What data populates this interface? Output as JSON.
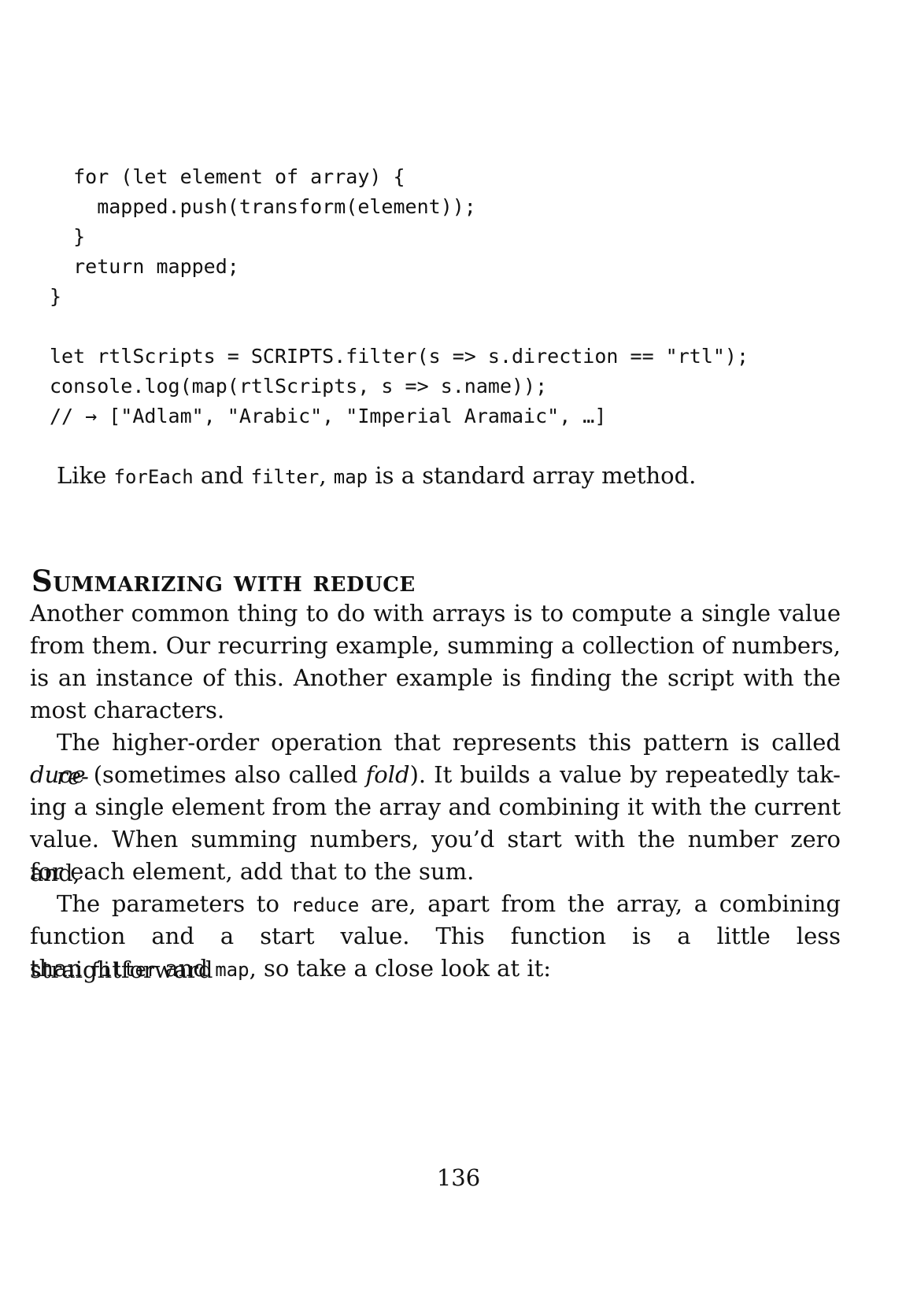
{
  "code": {
    "lines": [
      "  for (let element of array) {",
      "    mapped.push(transform(element));",
      "  }",
      "  return mapped;",
      "}",
      "",
      "let rtlScripts = SCRIPTS.filter(s => s.direction == \"rtl\");",
      "console.log(map(rtlScripts, s => s.name));",
      "// → [\"Adlam\", \"Arabic\", \"Imperial Aramaic\", …]"
    ]
  },
  "intro": {
    "t1": "Like ",
    "c1": "forEach",
    "t2": " and ",
    "c2": "filter",
    "t3": ", ",
    "c3": "map",
    "t4": " is a standard array method."
  },
  "heading": "Summarizing with reduce",
  "p1": {
    "lines": [
      "Another common thing to do with arrays is to compute a single value",
      "from them. Our recurring example, summing a collection of numbers,",
      "is an instance of this. Another example is finding the script with the",
      "most characters."
    ]
  },
  "p2": {
    "l1a": "The higher-order operation that represents this pattern is called ",
    "l1b": "re-",
    "l2a": "duce",
    "l2b": " (sometimes also called ",
    "l2c": "fold",
    "l2d": "). It builds a value by repeatedly tak-",
    "l3": "ing a single element from the array and combining it with the current",
    "l4": "value. When summing numbers, you’d start with the number zero and,",
    "l5": "for each element, add that to the sum."
  },
  "p3": {
    "l1a": "The parameters to ",
    "l1b": "reduce",
    "l1c": " are, apart from the array, a combining",
    "l2": "function and a start value. This function is a little less straightforward",
    "l3a": "than ",
    "l3b": "filter",
    "l3c": " and ",
    "l3d": "map",
    "l3e": ", so take a close look at it:"
  },
  "page_number": "136"
}
